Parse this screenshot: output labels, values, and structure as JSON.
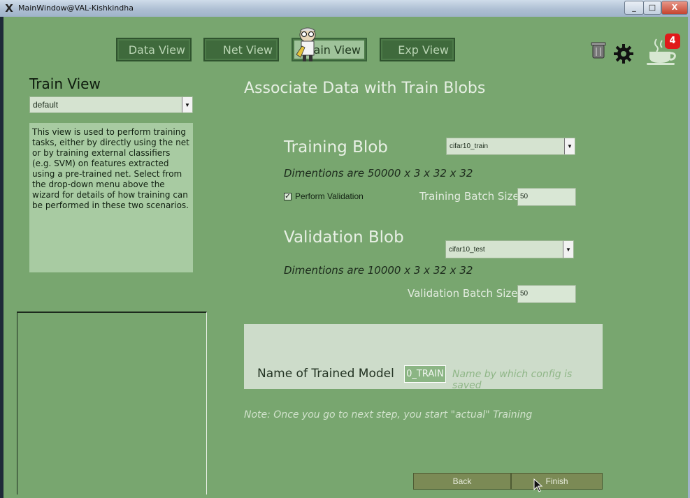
{
  "window": {
    "title": "MainWindow@VAL-Kishkindha",
    "app_icon": "X",
    "minimize": "_",
    "maximize": "□",
    "close": "X"
  },
  "nav": {
    "data_view": "Data View",
    "net_view": "Net View",
    "train_view": "Train View",
    "exp_view": "Exp View",
    "active": "train_view"
  },
  "toolbar": {
    "trash_icon": "trash-icon",
    "settings_icon": "gear-icon",
    "coffee_icon": "coffee-cup-icon",
    "notification_count": "4"
  },
  "sidebar": {
    "title": "Train View",
    "preset_select": "default",
    "description": "This view is used to perform training tasks, either by directly using the net or by training external classifiers (e.g. SVM) on features extracted using a pre-trained net. Select from the drop-down menu above the wizard for details of how training can be performed in these two scenarios."
  },
  "main": {
    "heading": "Associate Data with Train Blobs",
    "training_blob": {
      "title": "Training Blob",
      "select": "cifar10_train",
      "dimensions": "Dimentions are 50000 x 3 x 32 x 32",
      "perform_validation_label": "Perform Validation",
      "perform_validation_checked": true,
      "batch_size_label": "Training Batch Size :",
      "batch_size_value": "50"
    },
    "validation_blob": {
      "title": "Validation Blob",
      "select": "cifar10_test",
      "dimensions": "Dimentions are 10000 x 3 x 32 x 32",
      "batch_size_label": "Validation Batch Size :",
      "batch_size_value": "50"
    },
    "model": {
      "label": "Name of Trained Model",
      "value": "0_TRAIN",
      "hint": "Name by which config is saved"
    },
    "note": "Note: Once you go to next step, you start \"actual\" Training"
  },
  "footer": {
    "back": "Back",
    "finish": "Finish"
  },
  "colors": {
    "background": "#78a66f",
    "panel_light": "#a8cba2",
    "nav_button": "#3f6a3c",
    "badge": "#e01a1a"
  }
}
